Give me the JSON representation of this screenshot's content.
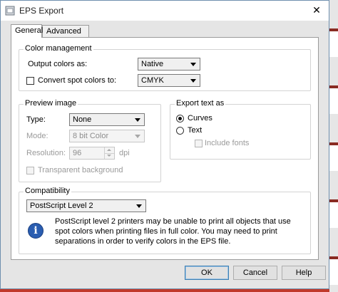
{
  "window": {
    "title": "EPS Export",
    "close_glyph": "✕"
  },
  "tabs": [
    {
      "label": "General",
      "active": true
    },
    {
      "label": "Advanced",
      "active": false
    }
  ],
  "color_management": {
    "title": "Color management",
    "output_colors_label": "Output colors as:",
    "output_colors_value": "Native",
    "convert_spot_label": "Convert spot colors to:",
    "convert_spot_checked": false,
    "convert_spot_value": "CMYK"
  },
  "preview_image": {
    "title": "Preview image",
    "type_label": "Type:",
    "type_value": "None",
    "mode_label": "Mode:",
    "mode_value": "8 bit Color",
    "resolution_label": "Resolution:",
    "resolution_value": "96",
    "resolution_unit": "dpi",
    "transparent_label": "Transparent background"
  },
  "export_text": {
    "title": "Export text as",
    "curves_label": "Curves",
    "text_label": "Text",
    "selected": "Curves",
    "include_fonts_label": "Include fonts"
  },
  "compatibility": {
    "title": "Compatibility",
    "value": "PostScript Level 2",
    "info": "PostScript level 2 printers may be unable to print all objects that use spot colors when printing files in full color. You may need to print separations in order to verify colors in the EPS file."
  },
  "buttons": {
    "ok": "OK",
    "cancel": "Cancel",
    "help": "Help"
  },
  "icons": {
    "app": "eps-export-icon",
    "info": "info-icon",
    "close": "close-icon"
  },
  "colors": {
    "info_blue": "#2a5db0",
    "window_bg": "#e5e5e5"
  }
}
